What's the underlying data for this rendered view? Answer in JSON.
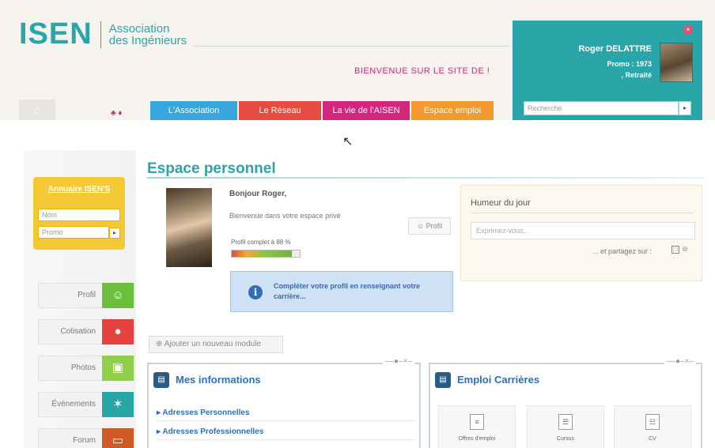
{
  "header": {
    "logo_main": "ISEN",
    "logo_sub_1": "Association",
    "logo_sub_2": "des Ingénieurs",
    "welcome": "BIENVENUE SUR LE SITE DE !",
    "home_icon": "home-icon",
    "lang": "♣ ♦",
    "nav": [
      {
        "label": "L'Association",
        "color": "#37a6dc"
      },
      {
        "label": "Le Réseau",
        "color": "#e54b3f"
      },
      {
        "label": "La vie de l'AISEN",
        "color": "#d4267d"
      },
      {
        "label": "Espace emploi",
        "color": "#f29a2e"
      }
    ]
  },
  "user": {
    "name": "Roger DELATTRE",
    "promo": "Promo : 1973",
    "status": ", Retraité",
    "close_icon": "close-icon",
    "search_placeholder": "Recherche",
    "search_btn": "▸"
  },
  "sidebar": {
    "annuaire_title": "Annuaire ISEN'S",
    "nom_placeholder": "Nom",
    "promo_placeholder": "Promo",
    "go": "▸",
    "items": [
      {
        "label": "Profil",
        "icon": "people-icon",
        "glyph": "☺",
        "color": "#6cbf3c"
      },
      {
        "label": "Cotisation",
        "icon": "piggy-bank-icon",
        "glyph": "●",
        "color": "#e5413e"
      },
      {
        "label": "Photos",
        "icon": "camera-icon",
        "glyph": "▣",
        "color": "#8fcf4a"
      },
      {
        "label": "Évènements",
        "icon": "cocktail-icon",
        "glyph": "✶",
        "color": "#2aa5a8"
      },
      {
        "label": "Forum",
        "icon": "chat-icon",
        "glyph": "▭",
        "color": "#d05a25"
      }
    ]
  },
  "main": {
    "title": "Espace personnel",
    "bonjour": "Bonjour Roger,",
    "bienvenue": "Bienvenue dans votre espace privé",
    "profil_btn": "☺ Profil",
    "completion_label": "Profil complet à 88 %",
    "completion": 0.88,
    "info_text": "Compléter votre profil en renseignant votre carrière...",
    "info_glyph": "i",
    "humeur_title": "Humeur du jour",
    "humeur_placeholder": "Exprimez-vous...",
    "humeur_share": "... et partagez sur :",
    "share_glyph_1": "□",
    "share_glyph_2": "◎",
    "add_module": "⊕ Ajouter un nouveau module"
  },
  "modules": {
    "controls": "––●–×–",
    "infos": {
      "title": "Mes informations",
      "icon_glyph": "▤",
      "links": [
        "▸ Adresses Personnelles",
        "▸ Adresses Professionnelles"
      ]
    },
    "emploi": {
      "title": "Emploi Carrières",
      "icon_glyph": "▤",
      "tiles": [
        {
          "label": "Offres d'emploi",
          "glyph": "≡"
        },
        {
          "label": "Cursus",
          "glyph": "☰"
        },
        {
          "label": "CV",
          "glyph": "☷"
        }
      ]
    }
  }
}
